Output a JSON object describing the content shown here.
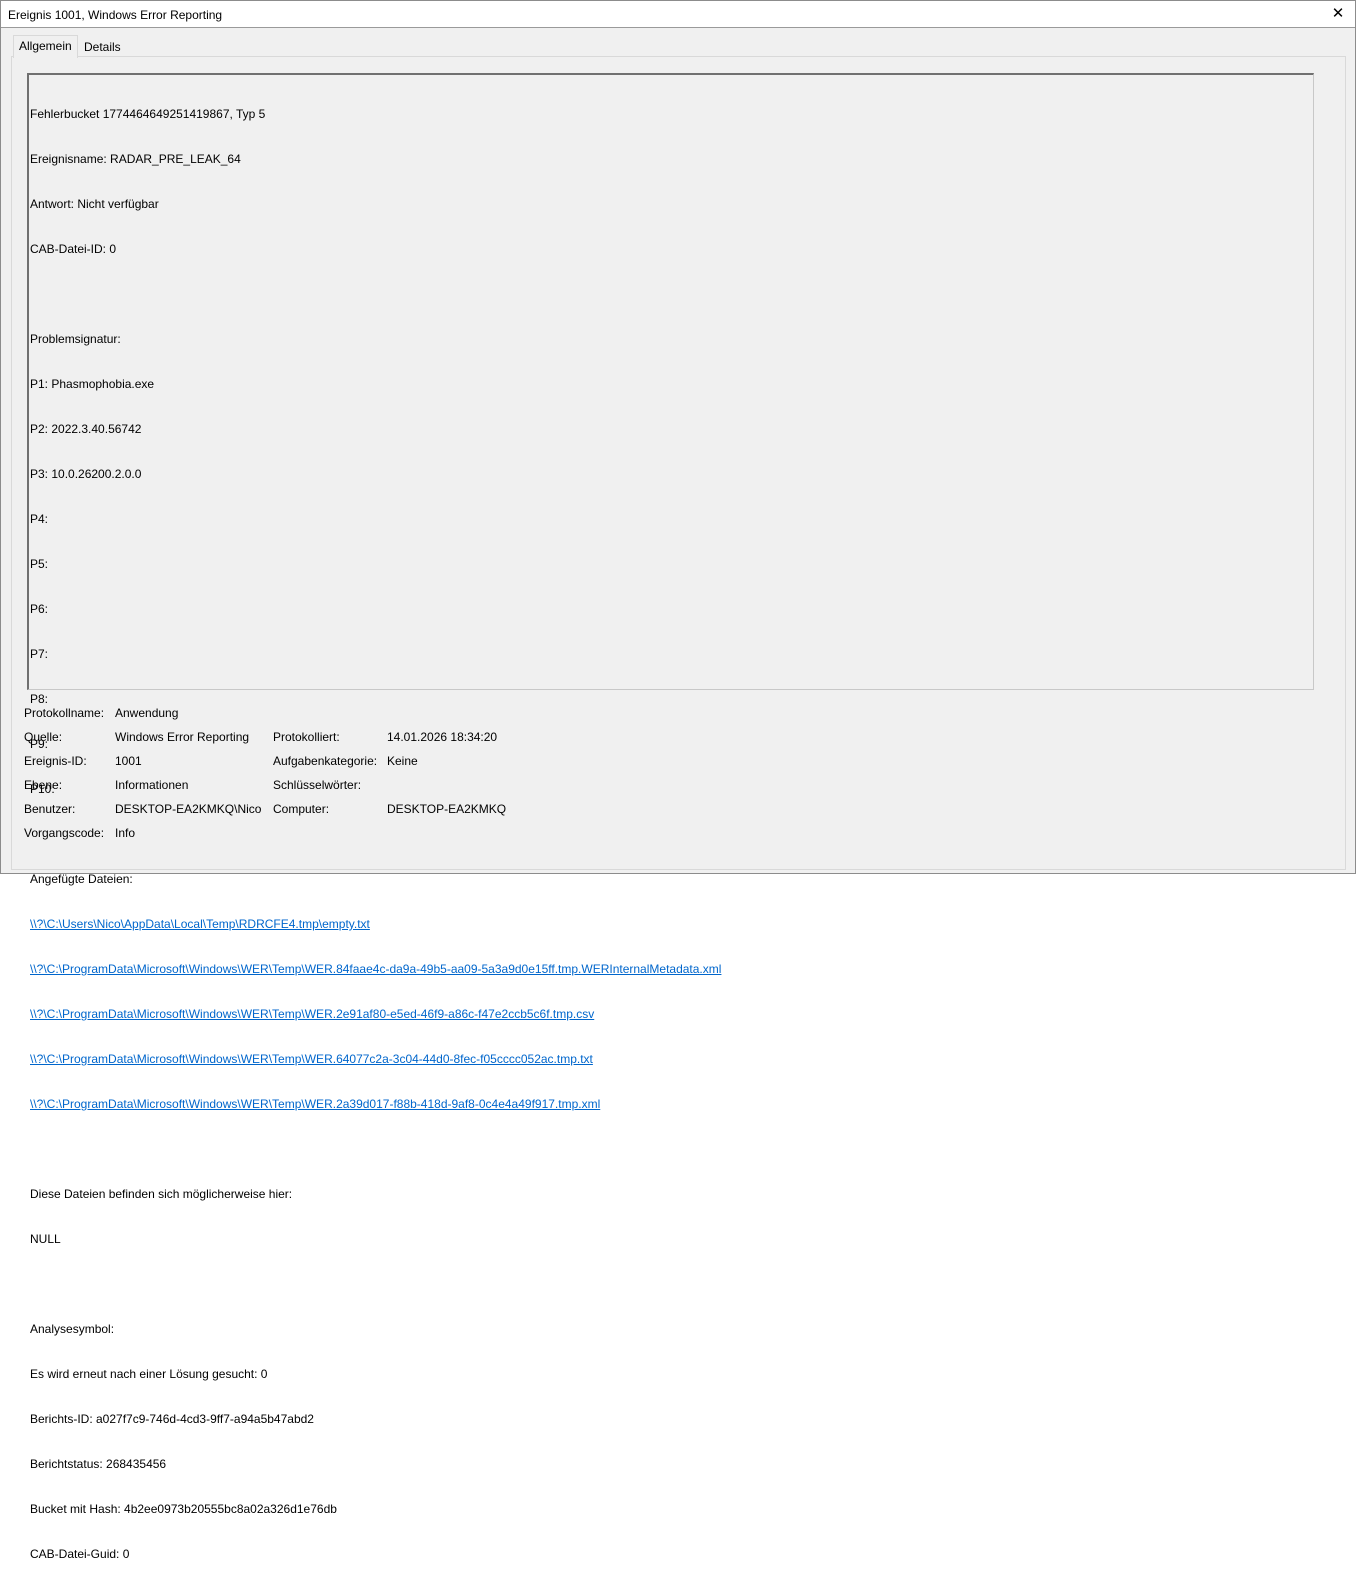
{
  "window": {
    "title": "Ereignis 1001, Windows Error Reporting",
    "close_glyph": "✕"
  },
  "tabs": [
    {
      "label": "Allgemein",
      "active": true
    },
    {
      "label": "Details",
      "active": false
    }
  ],
  "description": {
    "header": [
      "Fehlerbucket 1774464649251419867, Typ 5",
      "Ereignisname: RADAR_PRE_LEAK_64",
      "Antwort: Nicht verfügbar",
      "CAB-Datei-ID: 0"
    ],
    "signature_title": "Problemsignatur:",
    "signature": [
      "P1: Phasmophobia.exe",
      "P2: 2022.3.40.56742",
      "P3: 10.0.26200.2.0.0",
      "P4:",
      "P5:",
      "P6:",
      "P7:",
      "P8:",
      "P9:",
      "P10:"
    ],
    "attached_title": "Angefügte Dateien:",
    "attached_files": [
      "\\\\?\\C:\\Users\\Nico\\AppData\\Local\\Temp\\RDRCFE4.tmp\\empty.txt",
      "\\\\?\\C:\\ProgramData\\Microsoft\\Windows\\WER\\Temp\\WER.84faae4c-da9a-49b5-aa09-5a3a9d0e15ff.tmp.WERInternalMetadata.xml",
      "\\\\?\\C:\\ProgramData\\Microsoft\\Windows\\WER\\Temp\\WER.2e91af80-e5ed-46f9-a86c-f47e2ccb5c6f.tmp.csv",
      "\\\\?\\C:\\ProgramData\\Microsoft\\Windows\\WER\\Temp\\WER.64077c2a-3c04-44d0-8fec-f05cccc052ac.tmp.txt",
      "\\\\?\\C:\\ProgramData\\Microsoft\\Windows\\WER\\Temp\\WER.2a39d017-f88b-418d-9af8-0c4e4a49f917.tmp.xml"
    ],
    "location_title": "Diese Dateien befinden sich möglicherweise hier:",
    "location_value": "NULL",
    "analysis": [
      "Analysesymbol:",
      "Es wird erneut nach einer Lösung gesucht: 0",
      "Berichts-ID: a027f7c9-746d-4cd3-9ff7-a94a5b47abd2",
      "Berichtstatus: 268435456",
      "Bucket mit Hash: 4b2ee0973b20555bc8a02a326d1e76db",
      "CAB-Datei-Guid: 0"
    ]
  },
  "properties": {
    "log_name_label": "Protokollname:",
    "log_name_value": "Anwendung",
    "source_label": "Quelle:",
    "source_value": "Windows Error Reporting",
    "logged_label": "Protokolliert:",
    "logged_value": "14.01.2026 18:34:20",
    "event_id_label": "Ereignis-ID:",
    "event_id_value": "1001",
    "task_category_label": "Aufgabenkategorie:",
    "task_category_value": "Keine",
    "level_label": "Ebene:",
    "level_value": "Informationen",
    "keywords_label": "Schlüsselwörter:",
    "keywords_value": "",
    "user_label": "Benutzer:",
    "user_value": "DESKTOP-EA2KMKQ\\Nico",
    "computer_label": "Computer:",
    "computer_value": "DESKTOP-EA2KMKQ",
    "opcode_label": "Vorgangscode:",
    "opcode_value": "Info"
  }
}
